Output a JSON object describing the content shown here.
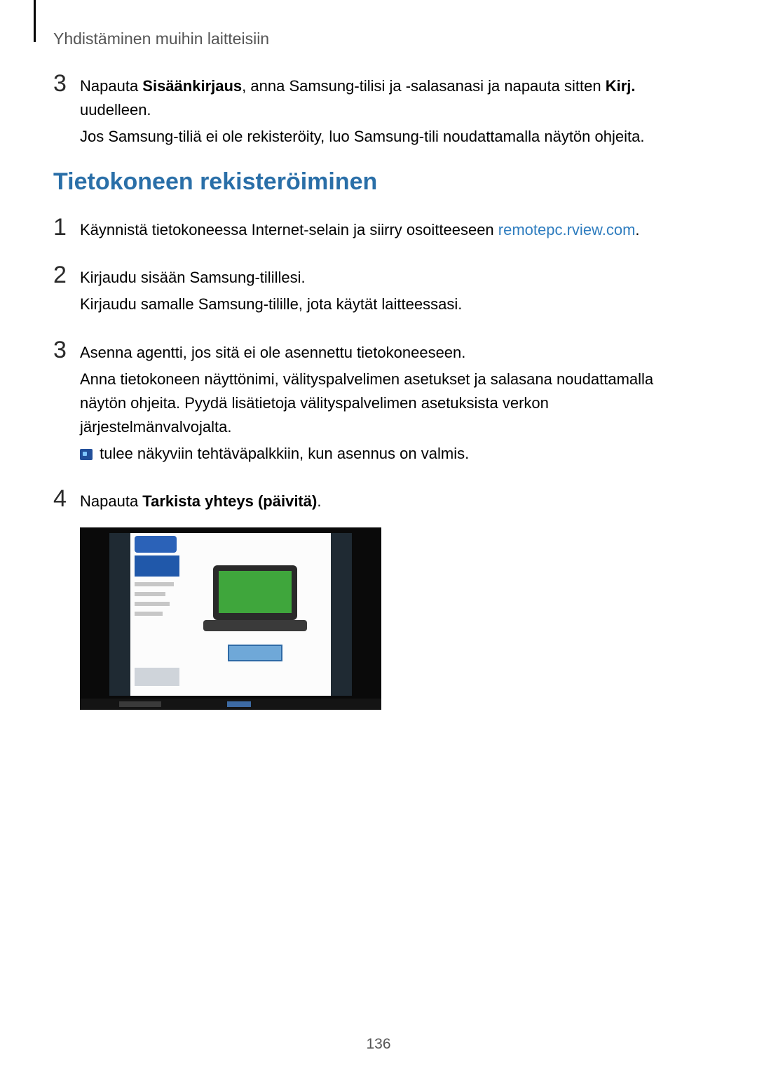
{
  "header": {
    "title": "Yhdistäminen muihin laitteisiin"
  },
  "intro_step": {
    "num": "3",
    "t1a": "Napauta ",
    "t1b": "Sisäänkirjaus",
    "t1c": ", anna Samsung-tilisi ja -salasanasi ja napauta sitten ",
    "t1d": "Kirj.",
    "t1e": " uudelleen.",
    "t2": "Jos Samsung-tiliä ei ole rekisteröity, luo Samsung-tili noudattamalla näytön ohjeita."
  },
  "section": {
    "heading": "Tietokoneen rekisteröiminen"
  },
  "steps": [
    {
      "num": "1",
      "t1a": "Käynnistä tietokoneessa Internet-selain ja siirry osoitteeseen ",
      "link": "remotepc.rview.com",
      "t1b": "."
    },
    {
      "num": "2",
      "t1": "Kirjaudu sisään Samsung-tilillesi.",
      "t2": "Kirjaudu samalle Samsung-tilille, jota käytät laitteessasi."
    },
    {
      "num": "3",
      "t1": "Asenna agentti, jos sitä ei ole asennettu tietokoneeseen.",
      "t2": "Anna tietokoneen näyttönimi, välityspalvelimen asetukset ja salasana noudattamalla näytön ohjeita. Pyydä lisätietoja välityspalvelimen asetuksista verkon järjestelmänvalvojalta.",
      "t3": " tulee näkyviin tehtäväpalkkiin, kun asennus on valmis."
    },
    {
      "num": "4",
      "t1a": "Napauta ",
      "t1b": "Tarkista yhteys (päivitä)",
      "t1c": "."
    }
  ],
  "page": {
    "number": "136"
  }
}
